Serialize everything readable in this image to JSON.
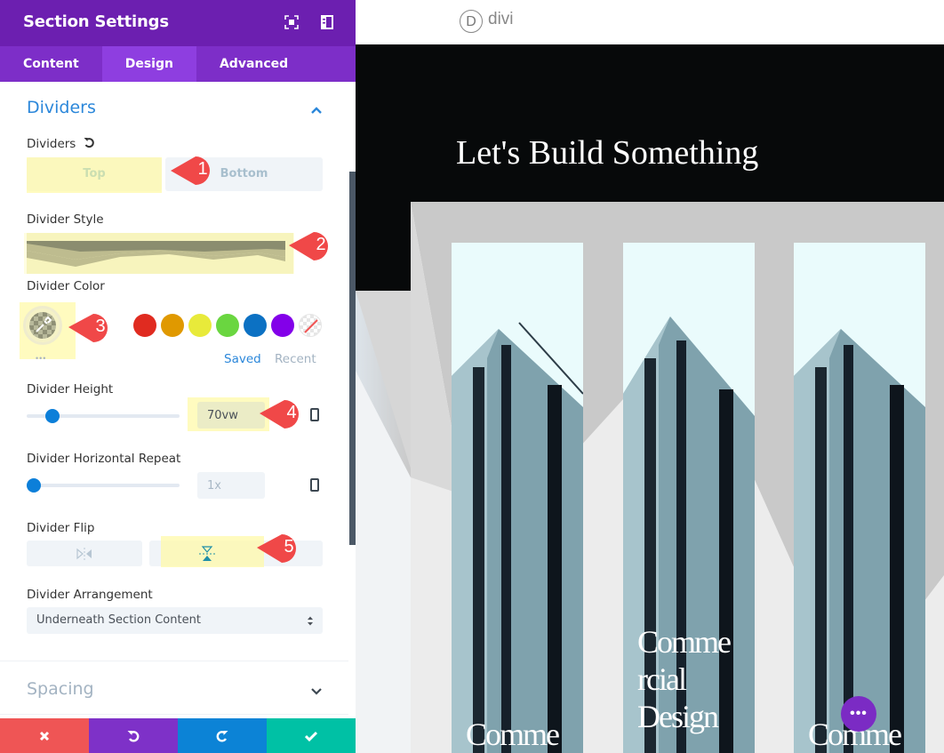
{
  "panel": {
    "title": "Section Settings",
    "header_icons": [
      "fullscreen-icon",
      "sidebar-layout-icon"
    ],
    "tabs": [
      {
        "label": "Content",
        "active": false
      },
      {
        "label": "Design",
        "active": true
      },
      {
        "label": "Advanced",
        "active": false
      }
    ],
    "dividers_section": {
      "title": "Dividers",
      "expanded": true,
      "dividers_label": "Dividers",
      "position_options": {
        "top": "Top",
        "bottom": "Bottom",
        "selected": "Top"
      },
      "style_label": "Divider Style",
      "color_label": "Divider Color",
      "color_swatches": [
        {
          "name": "red",
          "color": "#e02b20"
        },
        {
          "name": "orange",
          "color": "#e09900"
        },
        {
          "name": "yellow",
          "color": "#edf000"
        },
        {
          "name": "green",
          "color": "#7cda24"
        },
        {
          "name": "blue",
          "color": "#0c71c3"
        },
        {
          "name": "purple",
          "color": "#8300e9"
        },
        {
          "name": "transparent",
          "color": "transparent"
        }
      ],
      "color_tabs": {
        "saved": "Saved",
        "recent": "Recent"
      },
      "more_dots": "•••",
      "height_label": "Divider Height",
      "height_value": "70vw",
      "height_slider_fraction": 0.17,
      "repeat_label": "Divider Horizontal Repeat",
      "repeat_value": "1x",
      "repeat_slider_fraction": 0.0,
      "flip_label": "Divider Flip",
      "flip_selected": "vertical",
      "arrangement_label": "Divider Arrangement",
      "arrangement_value": "Underneath Section Content"
    },
    "spacing_section": {
      "title": "Spacing",
      "expanded": false
    },
    "footer_buttons": [
      {
        "name": "cancel",
        "icon": "✖",
        "color": "#ef5555"
      },
      {
        "name": "undo",
        "icon": "↺",
        "color": "#7e31c8"
      },
      {
        "name": "redo",
        "icon": "↻",
        "color": "#0c83d6"
      },
      {
        "name": "save",
        "icon": "✔",
        "color": "#00c1a5"
      }
    ]
  },
  "annotations": [
    "1",
    "2",
    "3",
    "4",
    "5"
  ],
  "preview": {
    "logo_letter": "D",
    "logo_text": "divi",
    "hero_title": "Let's Build Something",
    "cards": [
      {
        "caption": "Comme"
      },
      {
        "caption_lines": [
          "Comme",
          "rcial",
          "Design"
        ]
      },
      {
        "caption": "Comme"
      }
    ],
    "fab_label": "•••"
  }
}
